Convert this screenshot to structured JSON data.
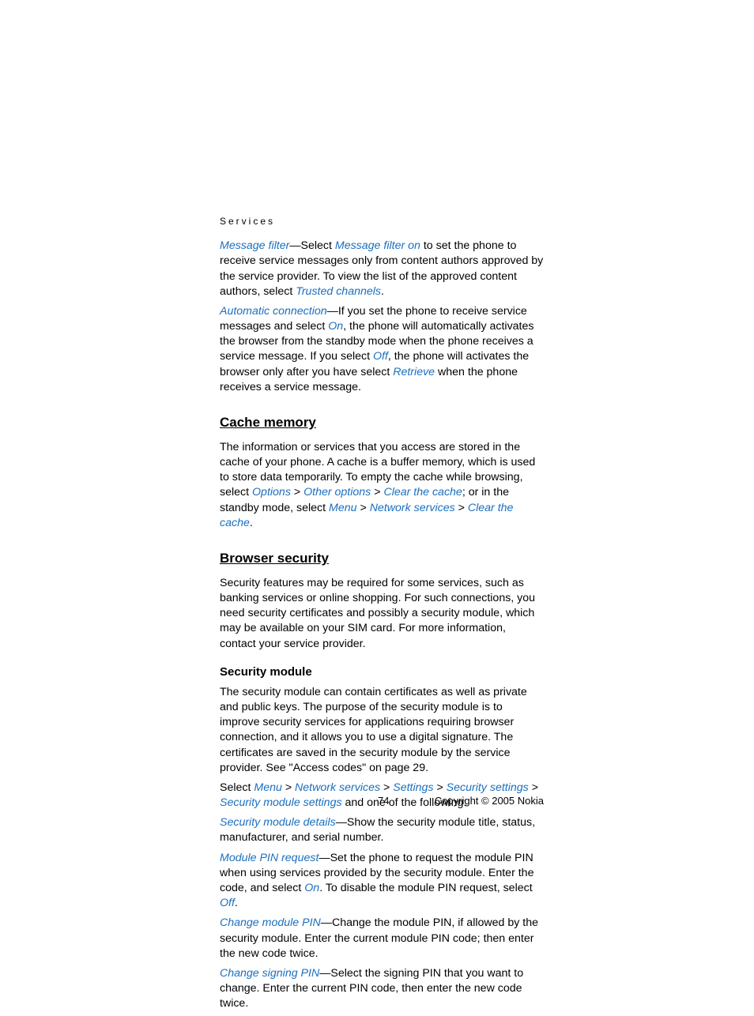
{
  "header": "Services",
  "p1": {
    "link1": "Message filter",
    "t1": "—Select ",
    "link2": "Message filter on",
    "t2": " to set the phone to receive service messages only from content authors approved by the service provider. To view the list of the approved content authors, select ",
    "link3": "Trusted channels",
    "t3": "."
  },
  "p2": {
    "link1": "Automatic connection",
    "t1": "—If you set the phone to receive service messages and select ",
    "link2": "On",
    "t2": ", the phone will automatically activates the browser from the standby mode when the phone receives a service message. If you select ",
    "link3": "Off",
    "t3": ", the phone will activates the browser only after you have select ",
    "link4": "Retrieve",
    "t4": " when the phone receives a service message."
  },
  "cache": {
    "heading": "Cache memory",
    "p": {
      "t1": "The information or services that you access are stored in the cache of your phone. A cache is a buffer memory, which is used to store data temporarily. To empty the cache while browsing, select ",
      "l1": "Options",
      "s": " > ",
      "l2": "Other options",
      "l3": "Clear the cache",
      "t2": "; or in the standby mode, select ",
      "l4": "Menu",
      "l5": "Network services",
      "l6": "Clear the cache",
      "t3": "."
    }
  },
  "browser": {
    "heading": "Browser security",
    "p1": "Security features may be required for some services, such as banking services or online shopping. For such connections, you need security certificates and possibly a security module, which may be available on your SIM card. For more information, contact your service provider.",
    "sub": "Security module",
    "p2": "The security module can contain certificates as well as private and public keys. The purpose of the security module is to improve security services for applications requiring browser connection, and it allows you to use a digital signature. The certificates are saved in the security module by the service provider. See \"Access codes\" on page 29.",
    "p3": {
      "t1": "Select ",
      "l1": "Menu",
      "s": " > ",
      "l2": "Network services",
      "l3": "Settings",
      "l4": "Security settings",
      "l5": "Security module settings",
      "t2": " and one of the following:"
    },
    "p4": {
      "l1": "Security module details",
      "t1": "—Show the security module title, status, manufacturer, and serial number."
    },
    "p5": {
      "l1": "Module PIN request",
      "t1": "—Set the phone to request the module PIN when using services provided by the security module. Enter the code, and select ",
      "l2": "On",
      "t2": ". To disable the module PIN request, select ",
      "l3": "Off",
      "t3": "."
    },
    "p6": {
      "l1": "Change module PIN",
      "t1": "—Change the module PIN, if allowed by the security module. Enter the current module PIN code; then enter the new code twice."
    },
    "p7": {
      "l1": "Change signing PIN",
      "t1": "—Select the signing PIN that you want to change. Enter the current PIN code, then enter the new code twice."
    }
  },
  "footer": {
    "page": "74",
    "copyright": "Copyright © 2005 Nokia"
  }
}
